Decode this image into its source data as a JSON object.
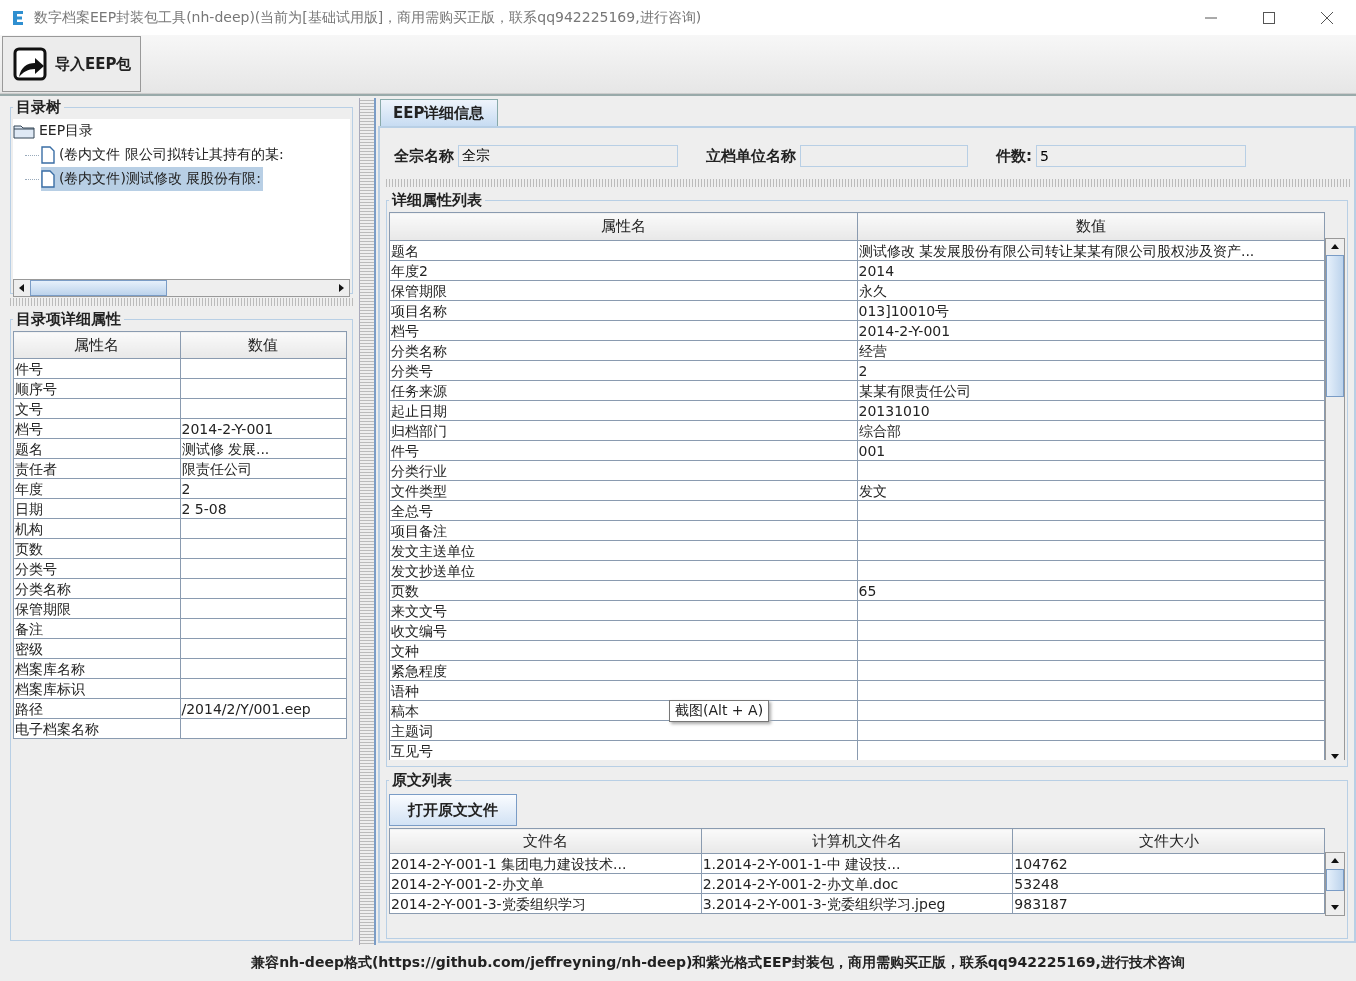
{
  "window": {
    "title": "数字档案EEP封装包工具(nh-deep)(当前为[基础试用版]，商用需购买正版，联系qq942225169,进行咨询)"
  },
  "toolbar": {
    "buttons": [
      {
        "label": "导入EEP包"
      }
    ]
  },
  "tree_panel": {
    "title": "目录树",
    "root": {
      "label": "EEP目录",
      "expanded": true,
      "children": [
        {
          "label": "(卷内文件 限公司拟转让其持有的某:",
          "selected": false
        },
        {
          "label": "(卷内文件)测试修改 展股份有限:",
          "selected": true
        }
      ]
    }
  },
  "item_properties": {
    "title": "目录项详细属性",
    "columns": [
      "属性名",
      "数值"
    ],
    "rows": [
      {
        "name": "件号"
      },
      {
        "name": "顺序号"
      },
      {
        "name": "文号"
      },
      {
        "name": "档号",
        "value": "2014-2-Y-001"
      },
      {
        "name": "题名",
        "value": "测试修 发展..."
      },
      {
        "name": "责任者",
        "value": "限责任公司"
      },
      {
        "name": "年度",
        "value": "2"
      },
      {
        "name": "日期",
        "value": "2 5-08"
      },
      {
        "name": "机构"
      },
      {
        "name": "页数"
      },
      {
        "name": "分类号"
      },
      {
        "name": "分类名称"
      },
      {
        "name": "保管期限"
      },
      {
        "name": "备注"
      },
      {
        "name": "密级"
      },
      {
        "name": "档案库名称"
      },
      {
        "name": "档案库标识"
      },
      {
        "name": "路径",
        "value": "/2014/2/Y/001.eep"
      },
      {
        "name": "电子档案名称"
      }
    ]
  },
  "detail_tabs": [
    {
      "label": "EEP详细信息",
      "selected": true
    }
  ],
  "fields": [
    {
      "label": "全宗名称",
      "value": "全宗"
    },
    {
      "label": "立档单位名称"
    },
    {
      "label": "件数:",
      "value": "5"
    }
  ],
  "detail_properties": {
    "title": "详细属性列表",
    "columns": [
      "属性名",
      "数值"
    ],
    "rows": [
      {
        "name": "题名",
        "value": "测试修改 某发展股份有限公司转让某某有限公司股权涉及资产..."
      },
      {
        "name": "年度2",
        "value": "2014"
      },
      {
        "name": "保管期限",
        "value": "永久"
      },
      {
        "name": "项目名称",
        "value": "013]10010号"
      },
      {
        "name": "档号",
        "value": "2014-2-Y-001"
      },
      {
        "name": "分类名称",
        "value": "经营"
      },
      {
        "name": "分类号",
        "value": "2"
      },
      {
        "name": "任务来源",
        "value": "某某有限责任公司"
      },
      {
        "name": "起止日期",
        "value": "20131010"
      },
      {
        "name": "归档部门",
        "value": "综合部"
      },
      {
        "name": "件号",
        "value": "001"
      },
      {
        "name": "分类行业"
      },
      {
        "name": "文件类型",
        "value": "发文"
      },
      {
        "name": "全总号"
      },
      {
        "name": "项目备注"
      },
      {
        "name": "发文主送单位"
      },
      {
        "name": "发文抄送单位"
      },
      {
        "name": "页数",
        "value": "65"
      },
      {
        "name": "来文文号"
      },
      {
        "name": "收文编号"
      },
      {
        "name": "文种"
      },
      {
        "name": "紧急程度"
      },
      {
        "name": "语种"
      },
      {
        "name": "稿本"
      },
      {
        "name": "主题词"
      },
      {
        "name": "互见号"
      }
    ]
  },
  "originals": {
    "title": "原文列表",
    "button": "打开原文文件",
    "columns": [
      "文件名",
      "计算机文件名",
      "文件大小"
    ],
    "rows": [
      [
        "2014-2-Y-001-1 集团电力建设技术...",
        "1.2014-2-Y-001-1-中 建设技...",
        "104762"
      ],
      [
        "2014-2-Y-001-2-办文单",
        "2.2014-2-Y-001-2-办文单.doc",
        "53248"
      ],
      [
        "2014-2-Y-001-3-党委组织学习",
        "3.2014-2-Y-001-3-党委组织学习.jpeg",
        "983187"
      ]
    ]
  },
  "tooltip": "截图(Alt + A)",
  "status_bar": "兼容nh-deep格式(https://github.com/jeffreyning/nh-deep)和紫光格式EEP封装包，商用需购买正版，联系qq942225169,进行技术咨询"
}
